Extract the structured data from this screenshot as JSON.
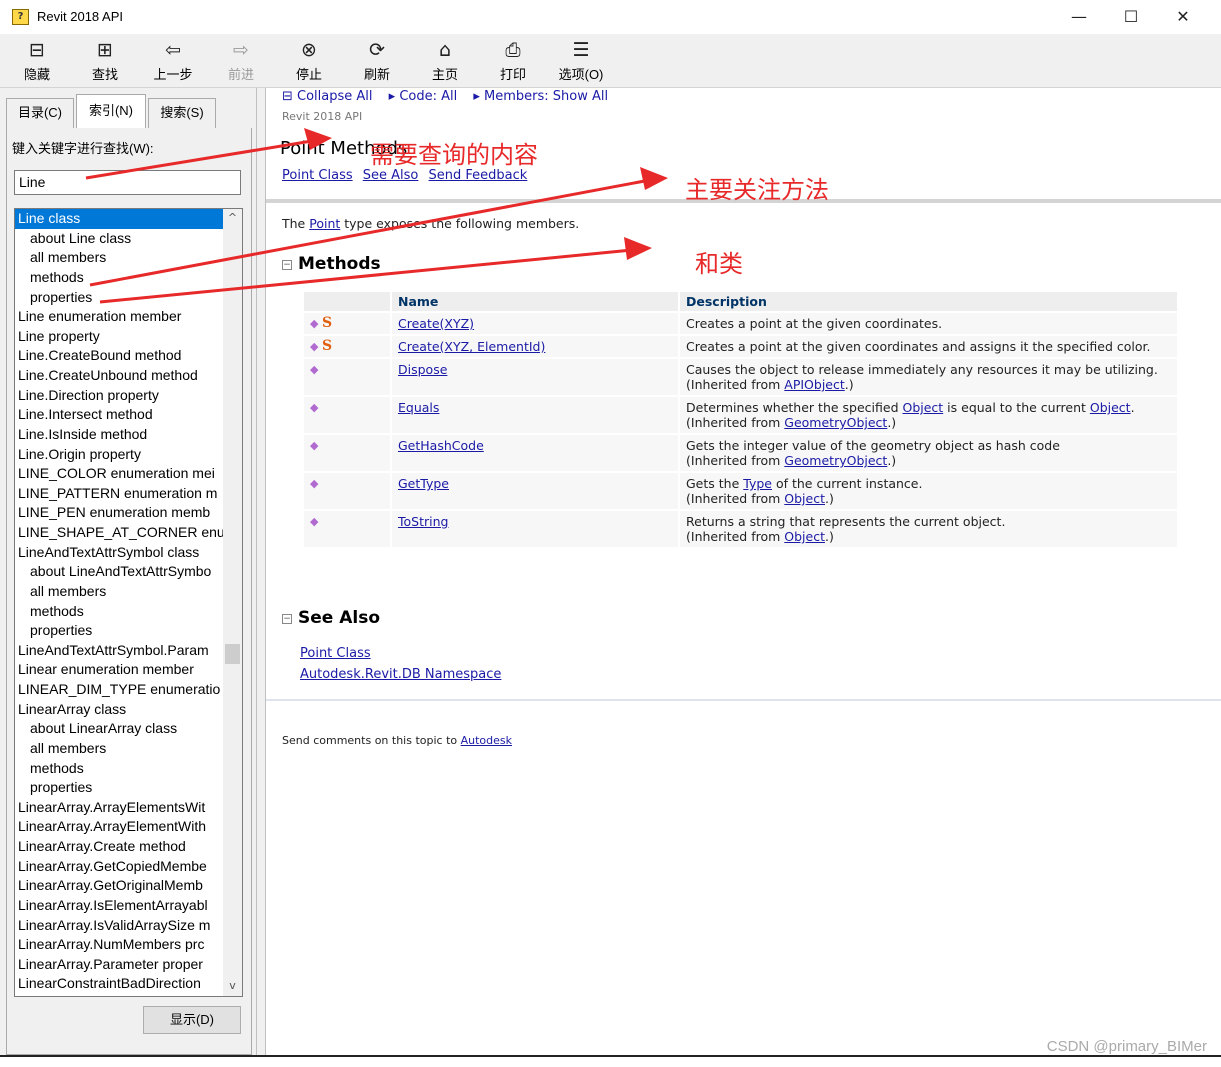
{
  "window": {
    "title": "Revit 2018 API",
    "minimize": "—",
    "maximize": "☐",
    "close": "✕"
  },
  "toolbar": [
    {
      "label": "隐藏",
      "icon": "hide-icon",
      "glyph": "⊟",
      "disabled": false
    },
    {
      "label": "查找",
      "icon": "locate-icon",
      "glyph": "⊞",
      "disabled": false
    },
    {
      "label": "上一步",
      "icon": "back-icon",
      "glyph": "⇦",
      "disabled": false
    },
    {
      "label": "前进",
      "icon": "forward-icon",
      "glyph": "⇨",
      "disabled": true
    },
    {
      "label": "停止",
      "icon": "stop-icon",
      "glyph": "⊗",
      "disabled": false
    },
    {
      "label": "刷新",
      "icon": "refresh-icon",
      "glyph": "⟳",
      "disabled": false
    },
    {
      "label": "主页",
      "icon": "home-icon",
      "glyph": "⌂",
      "disabled": false
    },
    {
      "label": "打印",
      "icon": "print-icon",
      "glyph": "⎙",
      "disabled": false
    },
    {
      "label": "选项(O)",
      "icon": "options-icon",
      "glyph": "☰",
      "disabled": false
    }
  ],
  "tabs": [
    {
      "label": "目录(C)",
      "active": false
    },
    {
      "label": "索引(N)",
      "active": true
    },
    {
      "label": "搜索(S)",
      "active": false
    }
  ],
  "index": {
    "keyword_label": "键入关键字进行查找(W):",
    "keyword_value": "Line",
    "items": [
      {
        "text": "Line class",
        "sub": false,
        "selected": true
      },
      {
        "text": "about Line class",
        "sub": true
      },
      {
        "text": "all members",
        "sub": true
      },
      {
        "text": "methods",
        "sub": true
      },
      {
        "text": "properties",
        "sub": true
      },
      {
        "text": "Line enumeration member",
        "sub": false
      },
      {
        "text": "Line property",
        "sub": false
      },
      {
        "text": "Line.CreateBound method",
        "sub": false
      },
      {
        "text": "Line.CreateUnbound method",
        "sub": false
      },
      {
        "text": "Line.Direction property",
        "sub": false
      },
      {
        "text": "Line.Intersect method",
        "sub": false
      },
      {
        "text": "Line.IsInside method",
        "sub": false
      },
      {
        "text": "Line.Origin property",
        "sub": false
      },
      {
        "text": "LINE_COLOR enumeration mei",
        "sub": false
      },
      {
        "text": "LINE_PATTERN enumeration m",
        "sub": false
      },
      {
        "text": "LINE_PEN enumeration memb",
        "sub": false
      },
      {
        "text": "LINE_SHAPE_AT_CORNER enur",
        "sub": false
      },
      {
        "text": "LineAndTextAttrSymbol class",
        "sub": false
      },
      {
        "text": "about LineAndTextAttrSymbo",
        "sub": true
      },
      {
        "text": "all members",
        "sub": true
      },
      {
        "text": "methods",
        "sub": true
      },
      {
        "text": "properties",
        "sub": true
      },
      {
        "text": "LineAndTextAttrSymbol.Param",
        "sub": false
      },
      {
        "text": "Linear enumeration member",
        "sub": false
      },
      {
        "text": "LINEAR_DIM_TYPE enumeratio",
        "sub": false
      },
      {
        "text": "LinearArray class",
        "sub": false
      },
      {
        "text": "about LinearArray class",
        "sub": true
      },
      {
        "text": "all members",
        "sub": true
      },
      {
        "text": "methods",
        "sub": true
      },
      {
        "text": "properties",
        "sub": true
      },
      {
        "text": "LinearArray.ArrayElementsWit",
        "sub": false
      },
      {
        "text": "LinearArray.ArrayElementWith",
        "sub": false
      },
      {
        "text": "LinearArray.Create method",
        "sub": false
      },
      {
        "text": "LinearArray.GetCopiedMembe",
        "sub": false
      },
      {
        "text": "LinearArray.GetOriginalMemb",
        "sub": false
      },
      {
        "text": "LinearArray.IsElementArrayabl",
        "sub": false
      },
      {
        "text": "LinearArray.IsValidArraySize m",
        "sub": false
      },
      {
        "text": "LinearArray.NumMembers prc",
        "sub": false
      },
      {
        "text": "LinearArray.Parameter proper",
        "sub": false
      },
      {
        "text": "LinearConstraintBadDirection",
        "sub": false
      }
    ],
    "scroll_up": "^",
    "scroll_down": "v",
    "show_button": "显示(D)"
  },
  "content": {
    "nav": [
      "⊟ Collapse All",
      "▸ Code: All",
      "▸ Members: Show All"
    ],
    "library": "Revit 2018 API",
    "title": "Point Methods",
    "links": [
      "Point Class",
      "See Also",
      "Send Feedback"
    ],
    "intro": {
      "before": "The ",
      "link": "Point",
      "after": " type exposes the following members."
    },
    "methods_heading": "Methods",
    "methods_toggle": "−",
    "table_headers": [
      "",
      "Name",
      "Description"
    ],
    "methods": [
      {
        "static": true,
        "name": "Create(XYZ)",
        "desc": [
          {
            "t": "Creates a point at the given coordinates."
          }
        ]
      },
      {
        "static": true,
        "name": "Create(XYZ, ElementId)",
        "desc": [
          {
            "t": "Creates a point at the given coordinates and assigns it the specified color."
          }
        ]
      },
      {
        "static": false,
        "name": "Dispose",
        "desc": [
          {
            "t": "Causes the object to release immediately any resources it may be utilizing."
          },
          {
            "br": true
          },
          {
            "t": "(Inherited from "
          },
          {
            "l": "APIObject"
          },
          {
            "t": ".)"
          }
        ]
      },
      {
        "static": false,
        "name": "Equals",
        "desc": [
          {
            "t": "Determines whether the specified "
          },
          {
            "l": "Object"
          },
          {
            "t": " is equal to the current "
          },
          {
            "l": "Object"
          },
          {
            "t": "."
          },
          {
            "br": true
          },
          {
            "t": "(Inherited from "
          },
          {
            "l": "GeometryObject"
          },
          {
            "t": ".)"
          }
        ]
      },
      {
        "static": false,
        "name": "GetHashCode",
        "desc": [
          {
            "t": "Gets the integer value of the geometry object as hash code"
          },
          {
            "br": true
          },
          {
            "t": "(Inherited from "
          },
          {
            "l": "GeometryObject"
          },
          {
            "t": ".)"
          }
        ]
      },
      {
        "static": false,
        "name": "GetType",
        "desc": [
          {
            "t": "Gets the "
          },
          {
            "l": "Type"
          },
          {
            "t": " of the current instance."
          },
          {
            "br": true
          },
          {
            "t": "(Inherited from "
          },
          {
            "l": "Object"
          },
          {
            "t": ".)"
          }
        ]
      },
      {
        "static": false,
        "name": "ToString",
        "desc": [
          {
            "t": "Returns a string that represents the current object."
          },
          {
            "br": true
          },
          {
            "t": "(Inherited from "
          },
          {
            "l": "Object"
          },
          {
            "t": ".)"
          }
        ]
      }
    ],
    "method_icon": "◆",
    "static_icon": "S",
    "see_also_heading": "See Also",
    "see_also": [
      "Point Class",
      "Autodesk.Revit.DB Namespace"
    ],
    "footer": {
      "text": "Send comments on this topic to ",
      "link": "Autodesk"
    }
  },
  "annotations": {
    "query": "需要查询的内容",
    "methods": "主要关注方法",
    "classes": "和类"
  },
  "watermark": "CSDN @primary_BIMer",
  "colors": {
    "annotation": "#e8292a",
    "link": "#1a1aa6",
    "selection": "#0078d7"
  }
}
